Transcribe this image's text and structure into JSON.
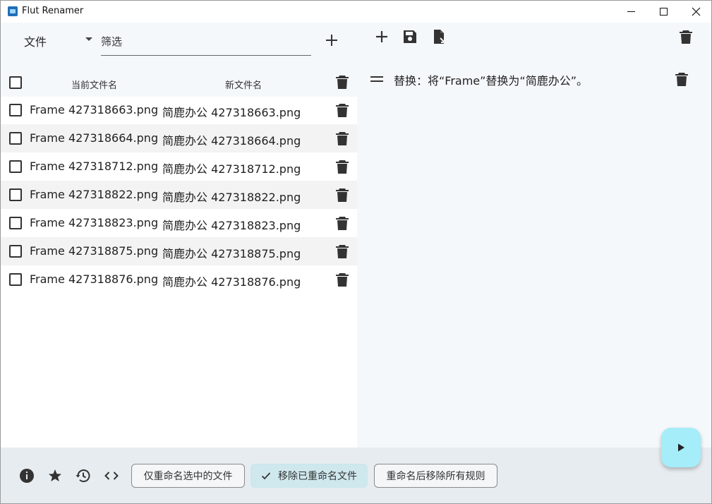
{
  "window": {
    "title": "Flut Renamer"
  },
  "left_panel": {
    "file_label": "文件",
    "filter_placeholder": "筛选",
    "header": {
      "current_name": "当前文件名",
      "new_name": "新文件名"
    },
    "files": [
      {
        "current": "Frame 427318663.png",
        "new": "简鹿办公 427318663.png"
      },
      {
        "current": "Frame 427318664.png",
        "new": "简鹿办公 427318664.png"
      },
      {
        "current": "Frame 427318712.png",
        "new": "简鹿办公 427318712.png"
      },
      {
        "current": "Frame 427318822.png",
        "new": "简鹿办公 427318822.png"
      },
      {
        "current": "Frame 427318823.png",
        "new": "简鹿办公 427318823.png"
      },
      {
        "current": "Frame 427318875.png",
        "new": "简鹿办公 427318875.png"
      },
      {
        "current": "Frame 427318876.png",
        "new": "简鹿办公 427318876.png"
      }
    ]
  },
  "right_panel": {
    "rules": [
      {
        "text": "替换：将“Frame”替换为“简鹿办公”。"
      }
    ]
  },
  "bottom_bar": {
    "rename_selected_label": "仅重命名选中的文件",
    "remove_renamed_label": "移除已重命名文件",
    "remove_rules_label": "重命名后移除所有规则"
  },
  "colors": {
    "panel_bg": "#f5f8fb",
    "bottom_bg": "#e7ecf0",
    "fab_bg": "#a5edf8",
    "selected_chip_bg": "#cfe8ee",
    "alt_row_bg": "#f3f3f3"
  },
  "icons": {
    "app": "flut-renamer-icon",
    "add": "plus-icon",
    "save": "save-icon",
    "load": "file-open-icon",
    "delete": "trash-icon",
    "drag": "drag-handle-icon",
    "info": "info-icon",
    "star": "star-icon",
    "history": "history-icon",
    "code": "code-icon",
    "check": "check-icon",
    "run": "play-icon"
  }
}
